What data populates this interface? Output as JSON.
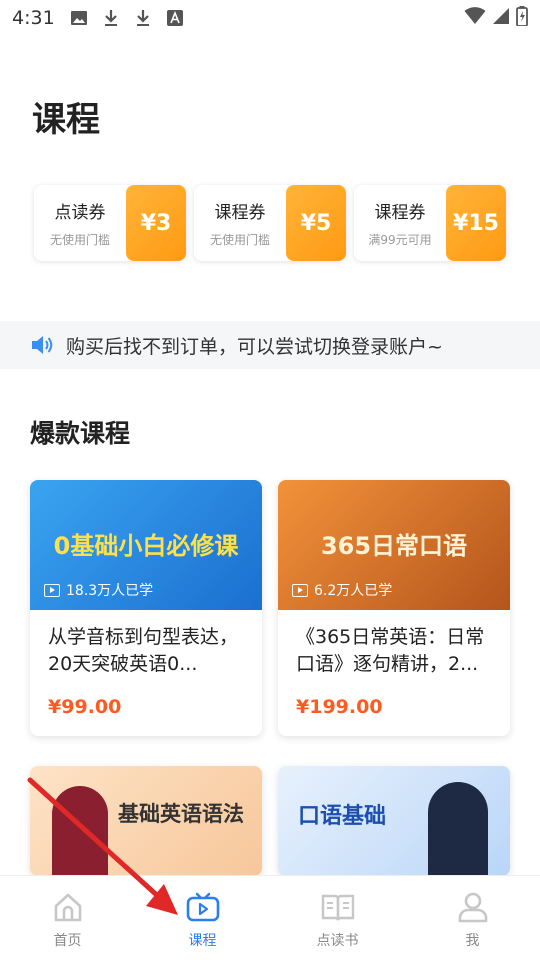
{
  "status": {
    "time": "4:31"
  },
  "page": {
    "title": "课程"
  },
  "coupons": [
    {
      "name": "点读券",
      "condition": "无使用门槛",
      "amount": "¥3"
    },
    {
      "name": "课程券",
      "condition": "无使用门槛",
      "amount": "¥5"
    },
    {
      "name": "课程券",
      "condition": "满99元可用",
      "amount": "¥15"
    }
  ],
  "notice": {
    "text": "购买后找不到订单，可以尝试切换登录账户~"
  },
  "section": {
    "title": "爆款课程"
  },
  "courses": [
    {
      "thumb_text": "0基础小白必修课",
      "learners": "18.3万人已学",
      "title": "从学音标到句型表达，20天突破英语0...",
      "price": "¥99.00"
    },
    {
      "thumb_text": "365日常口语",
      "learners": "6.2万人已学",
      "title": "《365日常英语：日常口语》逐句精讲，2...",
      "price": "¥199.00"
    },
    {
      "thumb_text": "基础英语语法"
    },
    {
      "thumb_text": "口语基础"
    }
  ],
  "tabs": [
    {
      "label": "首页"
    },
    {
      "label": "课程"
    },
    {
      "label": "点读书"
    },
    {
      "label": "我"
    }
  ],
  "colors": {
    "accent": "#2a7ef0",
    "price": "#ff5a1f",
    "coupon": "#ffa826"
  }
}
